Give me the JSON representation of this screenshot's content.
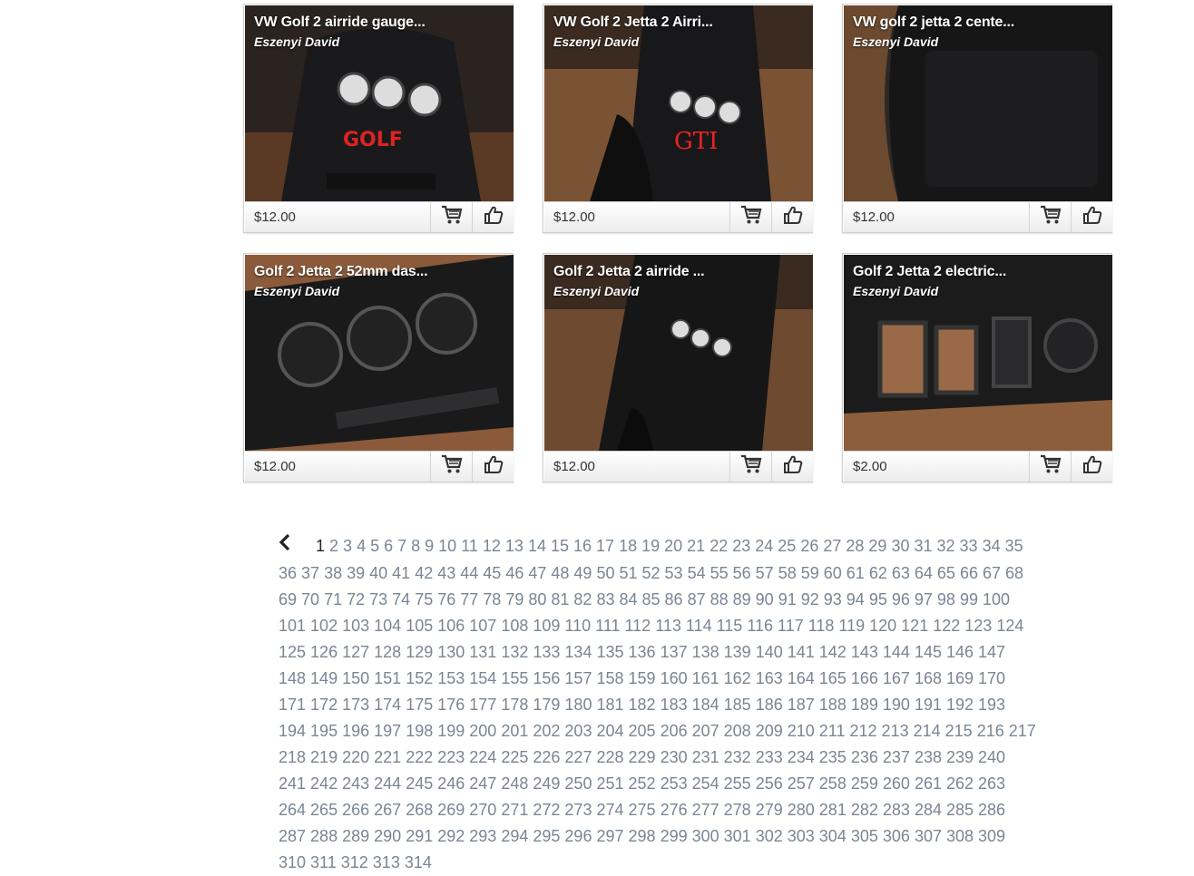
{
  "products": [
    {
      "title": "VW Golf 2 airride gauge...",
      "author": "Eszenyi David",
      "price": "$12.00",
      "badge": "GOLF",
      "theme": "golf"
    },
    {
      "title": "VW Golf 2 Jetta 2 Airri...",
      "author": "Eszenyi David",
      "price": "$12.00",
      "badge": "GTI",
      "theme": "gti"
    },
    {
      "title": "VW golf 2 jetta 2 cente...",
      "author": "Eszenyi David",
      "price": "$12.00",
      "badge": "",
      "theme": "plain"
    },
    {
      "title": "Golf 2 Jetta 2 52mm das...",
      "author": "Eszenyi David",
      "price": "$12.00",
      "badge": "",
      "theme": "dash"
    },
    {
      "title": "Golf 2 Jetta 2 airride ...",
      "author": "Eszenyi David",
      "price": "$12.00",
      "badge": "",
      "theme": "console"
    },
    {
      "title": "Golf 2 Jetta 2 electric...",
      "author": "Eszenyi David",
      "price": "$2.00",
      "badge": "",
      "theme": "switch"
    }
  ],
  "icons": {
    "cart": "cart-icon",
    "like": "thumbs-up-icon",
    "prev": "chevron-left-icon"
  },
  "pagination": {
    "current": "1",
    "last_visible": "314"
  }
}
